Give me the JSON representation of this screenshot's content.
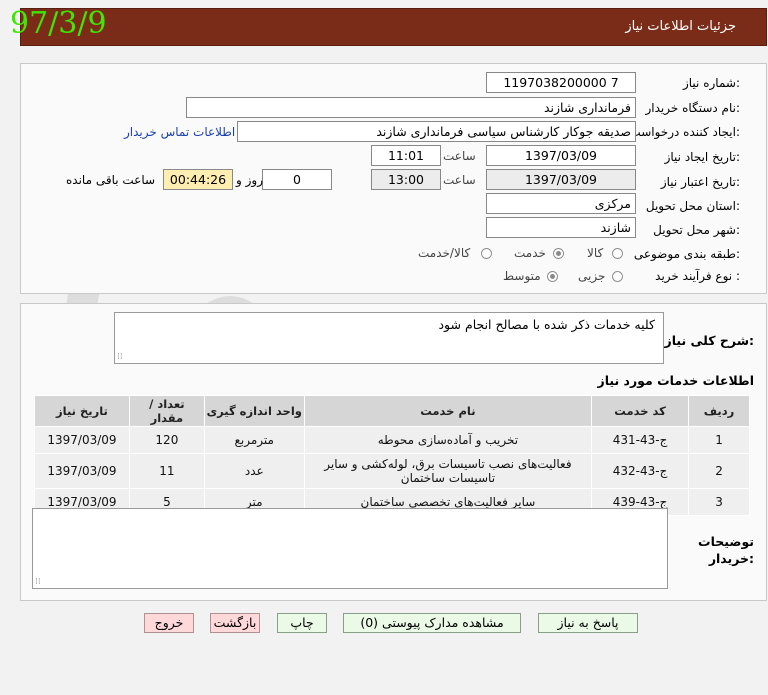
{
  "datestamp": "97/3/9",
  "page_title": "جزئیات اطلاعات نیاز",
  "form": {
    "need_number_label": "شماره نیاز:",
    "need_number": "1197038200000 7",
    "buyer_org_label": "نام دستگاه خریدار:",
    "buyer_org": "فرمانداری شازند",
    "creator_label": "ایجاد کننده درخواست:",
    "creator": "صدیقه جوکار کارشناس سیاسی فرمانداری شازند",
    "contact_link": "اطلاعات تماس خریدار",
    "created_date_label": "تاریخ ایجاد نیاز:",
    "created_date": "1397/03/09",
    "time_label": "ساعت",
    "created_time": "11:01",
    "validity_label": "تاریخ اعتبار نیاز:",
    "validity_date": "1397/03/09",
    "validity_time": "13:00",
    "days_remaining": "0",
    "day_and_label": "روز و",
    "time_remaining": "00:44:26",
    "remaining_label": "ساعت باقی مانده",
    "province_label": "استان محل تحویل:",
    "province": "مرکزی",
    "city_label": "شهر محل تحویل:",
    "city": "شازند",
    "category_label": "طبقه بندی موضوعی:",
    "category_options": [
      "کالا",
      "خدمت",
      "کالا/خدمت"
    ],
    "category_selected": "خدمت",
    "process_label": "نوع فرآیند خرید :",
    "process_options": [
      "جزیی",
      "متوسط"
    ],
    "process_selected": "متوسط"
  },
  "description": {
    "label": "شرح کلی نیاز:",
    "text": "کلیه خدمات ذکر شده با مصالح انجام شود"
  },
  "services": {
    "title": "اطلاعات خدمات مورد نیاز",
    "columns": [
      "ردیف",
      "کد خدمت",
      "نام خدمت",
      "واحد اندازه گیری",
      "تعداد / مقدار",
      "تاریخ نیاز"
    ],
    "rows": [
      [
        "1",
        "ج-43-431",
        "تخریب و آماده‌سازی محوطه",
        "مترمربع",
        "120",
        "1397/03/09"
      ],
      [
        "2",
        "ج-43-432",
        "فعالیت‌های نصب تاسیسات برق، لوله‌کشی و سایر تاسیسات ساختمان",
        "عدد",
        "11",
        "1397/03/09"
      ],
      [
        "3",
        "ج-43-439",
        "سایر فعالیت‌های تخصصی ساختمان",
        "متر",
        "5",
        "1397/03/09"
      ]
    ]
  },
  "buyer_notes": {
    "label": "توضیحات خریدار:",
    "text": ""
  },
  "buttons": {
    "reply": "پاسخ به نیاز",
    "attachments": "مشاهده مدارک پیوستی (0)",
    "print": "چاپ",
    "back": "بازگشت",
    "exit": "خروج"
  },
  "colors": {
    "header_bg": "#7a2c18",
    "datestamp": "#3ee800",
    "button_green": "#eafae6",
    "button_pink": "#ffd9d9",
    "timer_bg": "#ffeeb2"
  }
}
